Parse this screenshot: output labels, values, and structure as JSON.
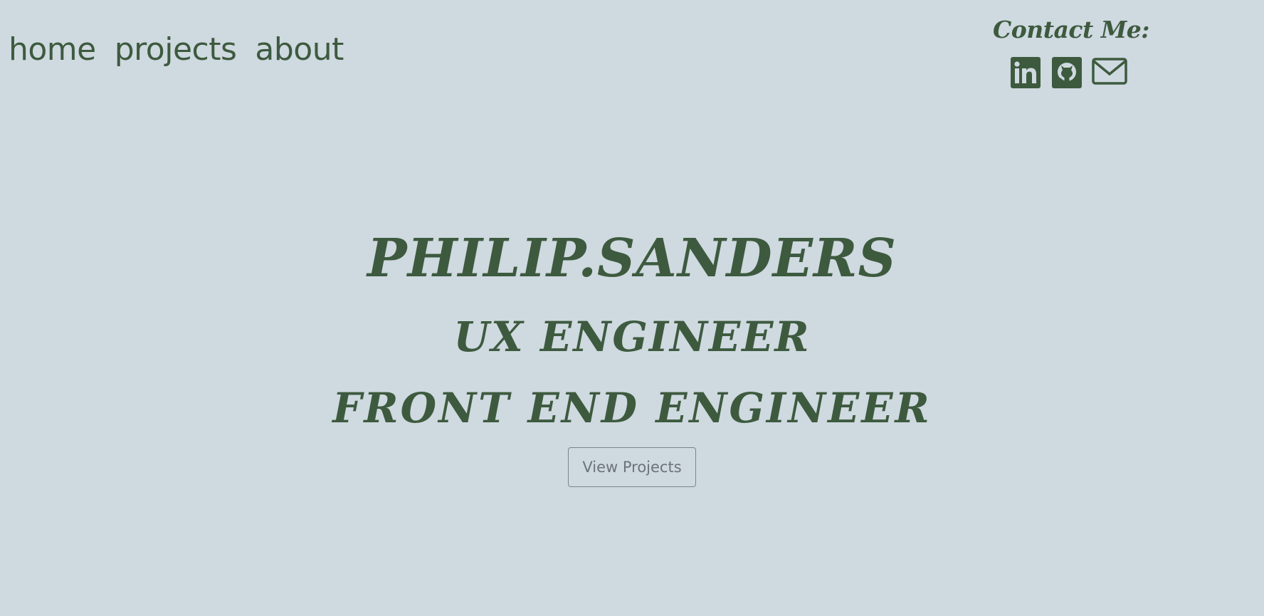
{
  "nav": {
    "items": [
      {
        "label": "home"
      },
      {
        "label": "projects"
      },
      {
        "label": "about"
      }
    ]
  },
  "contact": {
    "title": "Contact Me:",
    "links": [
      {
        "icon": "linkedin-icon"
      },
      {
        "icon": "github-icon"
      },
      {
        "icon": "email-icon"
      }
    ]
  },
  "hero": {
    "name": "PHILIP.SANDERS",
    "role_1": "UX ENGINEER",
    "role_2": "FRONT END ENGINEER",
    "cta_label": "View Projects"
  },
  "colors": {
    "background": "#cfd9e0",
    "accent": "#3d5a3e",
    "button_text": "#6c747a"
  }
}
